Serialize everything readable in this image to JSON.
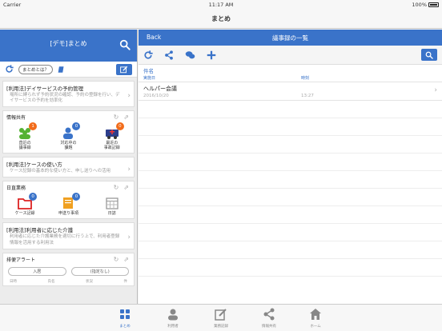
{
  "status": {
    "carrier": "Carrier",
    "time": "11:17 AM",
    "battery": "100%"
  },
  "nav": {
    "title": "まとめ"
  },
  "left": {
    "title": "[デモ]まとめ",
    "about_label": "まとめとは？",
    "cards": [
      {
        "title": "[利用法]デイサービスの予約管理",
        "desc": "場所に縛られず予約状況の確認、予約の登録を行い、デイサービスの予約を効率化"
      }
    ],
    "info": {
      "title": "情報共有",
      "tiles": [
        {
          "label1": "直近の",
          "label2": "議事録",
          "badge": "1"
        },
        {
          "label1": "対応中の",
          "label2": "課題",
          "badge": "0"
        },
        {
          "label1": "最近の",
          "label2": "事故記録",
          "badge": "0"
        }
      ]
    },
    "card2": {
      "title": "[利用法]ケースの使い方",
      "desc": "ケース記録の基本的な使い方と、申し送りへの活用"
    },
    "daily": {
      "title": "日直業務",
      "tiles": [
        {
          "label": "ケース記録",
          "badge": "0"
        },
        {
          "label": "申送り事項",
          "badge": "0"
        },
        {
          "label": "日誌"
        }
      ]
    },
    "card3": {
      "title": "[利用法]利用者に応じた介護",
      "desc": "利用者に応じた介護業務を適切に行う上で、利用者登録情報を活用する利用法"
    },
    "alert": {
      "title": "排便アラート",
      "select1": "入居",
      "select2": "(指定なし)",
      "cols": [
        "日時",
        "氏名",
        "状況",
        "件"
      ]
    }
  },
  "right": {
    "back": "Back",
    "title": "議事録の一覧",
    "header": {
      "main": "件名",
      "date": "実施日",
      "time": "時刻"
    },
    "rows": [
      {
        "title": "ヘルパー会議",
        "date": "2016/10/20",
        "time": "13:27"
      }
    ]
  },
  "tabs": [
    {
      "label": "まとめ",
      "icon": "grid-icon"
    },
    {
      "label": "利用者",
      "icon": "person-icon"
    },
    {
      "label": "業務記録",
      "icon": "pencil-icon"
    },
    {
      "label": "情報共有",
      "icon": "share-icon"
    },
    {
      "label": "ホーム",
      "icon": "home-icon"
    }
  ],
  "colors": {
    "accent": "#3a73c9",
    "badge_orange": "#f26c1b"
  }
}
